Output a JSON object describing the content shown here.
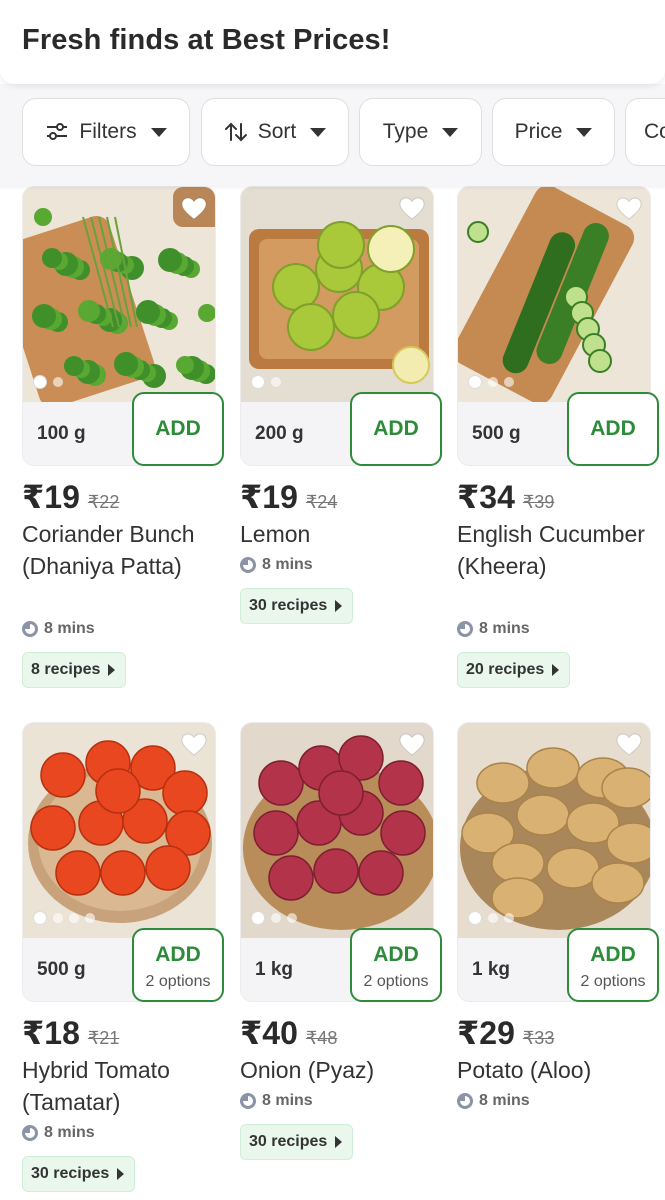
{
  "header": {
    "title": "Fresh finds at Best Prices!"
  },
  "filters": [
    {
      "label": "Filters",
      "icon": "sliders-icon"
    },
    {
      "label": "Sort",
      "icon": "sort-arrows-icon"
    },
    {
      "label": "Type",
      "icon": ""
    },
    {
      "label": "Price",
      "icon": ""
    },
    {
      "label": "Co",
      "icon": ""
    }
  ],
  "colors": {
    "accent": "#2e8b3a",
    "recipes_bg": "#e9f7ec"
  },
  "products": [
    {
      "name": "Coriander Bunch (Dhaniya Patta)",
      "weight": "100 g",
      "price": "₹19",
      "mrp": "₹22",
      "eta": "8 mins",
      "recipes": "8 recipes",
      "add": "ADD",
      "options": "",
      "image": "coriander"
    },
    {
      "name": "Lemon",
      "weight": "200 g",
      "price": "₹19",
      "mrp": "₹24",
      "eta": "8 mins",
      "recipes": "30 recipes",
      "add": "ADD",
      "options": "",
      "image": "lemon"
    },
    {
      "name": "English Cucumber (Kheera)",
      "weight": "500 g",
      "price": "₹34",
      "mrp": "₹39",
      "eta": "8 mins",
      "recipes": "20 recipes",
      "add": "ADD",
      "options": "",
      "image": "cucumber"
    },
    {
      "name": "Hybrid Tomato (Tamatar)",
      "weight": "500 g",
      "price": "₹18",
      "mrp": "₹21",
      "eta": "8 mins",
      "recipes": "30 recipes",
      "add": "ADD",
      "options": "2 options",
      "image": "tomato"
    },
    {
      "name": "Onion (Pyaz)",
      "weight": "1 kg",
      "price": "₹40",
      "mrp": "₹48",
      "eta": "8 mins",
      "recipes": "30 recipes",
      "add": "ADD",
      "options": "2 options",
      "image": "onion"
    },
    {
      "name": "Potato (Aloo)",
      "weight": "1 kg",
      "price": "₹29",
      "mrp": "₹33",
      "eta": "8 mins",
      "recipes": "",
      "add": "ADD",
      "options": "2 options",
      "image": "potato"
    }
  ]
}
